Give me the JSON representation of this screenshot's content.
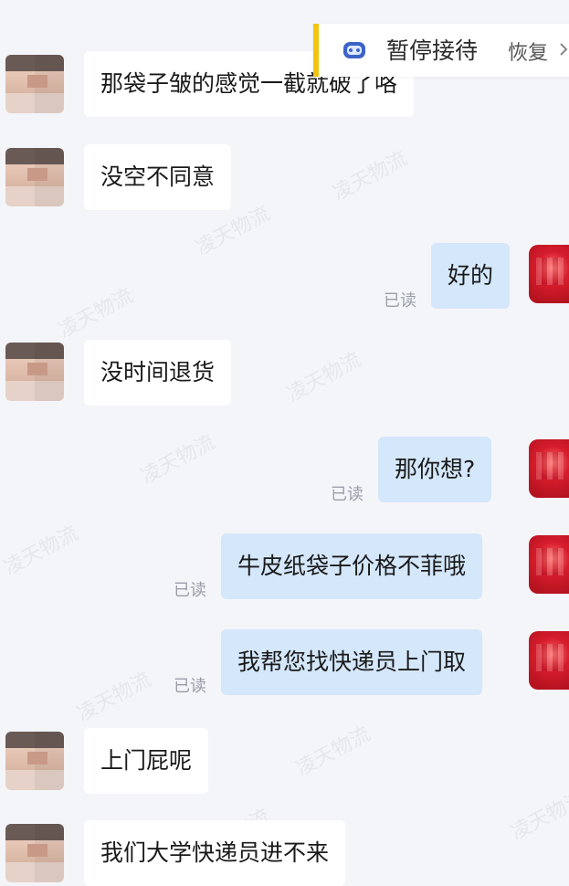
{
  "status": {
    "label": "暂停接待",
    "action": "恢复",
    "icon": "robot-icon",
    "accent_color": "#f1c40f"
  },
  "watermark_text": "凌天物流",
  "messages": [
    {
      "sender": "customer",
      "text": "那袋子皱的感觉一截就破了咯"
    },
    {
      "sender": "customer",
      "text": "没空不同意"
    },
    {
      "sender": "agent",
      "text": "好的",
      "status": "已读"
    },
    {
      "sender": "customer",
      "text": "没时间退货"
    },
    {
      "sender": "agent",
      "text": "那你想?",
      "status": "已读"
    },
    {
      "sender": "agent",
      "text": "牛皮纸袋子价格不菲哦",
      "status": "已读"
    },
    {
      "sender": "agent",
      "text": "我帮您找快递员上门取",
      "status": "已读"
    },
    {
      "sender": "customer",
      "text": "上门屁呢"
    },
    {
      "sender": "customer",
      "text": "我们大学快递员进不来"
    }
  ],
  "colors": {
    "background": "#f4f5f9",
    "incoming_bubble": "#ffffff",
    "outgoing_bubble": "#d4e7fb",
    "read_text": "#9a9ea8"
  }
}
